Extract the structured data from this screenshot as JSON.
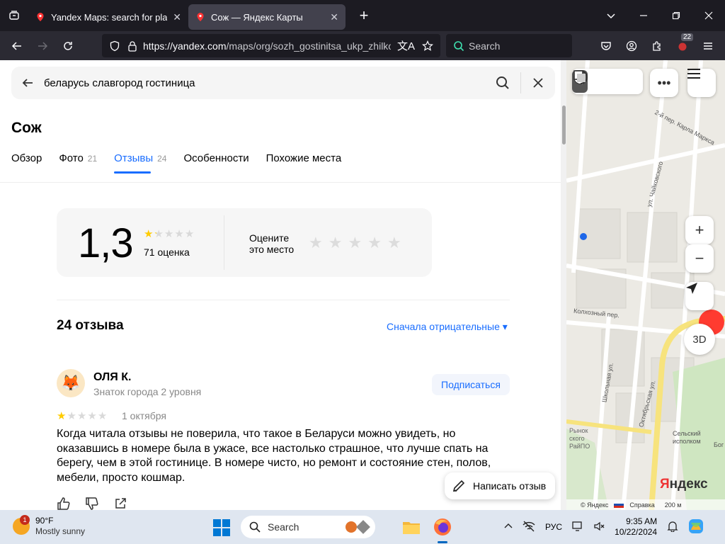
{
  "browser": {
    "tabs": [
      {
        "title": "Yandex Maps: search for places,",
        "close": "✕"
      },
      {
        "title": "Сож — Яндекс Карты",
        "close": "✕"
      }
    ],
    "url_host": "https://yandex.com",
    "url_path": "/maps/org/sozh_gostinitsa_ukp_zhilkom",
    "search_placeholder": "Search",
    "extension_badge": "22"
  },
  "page": {
    "search_query": "беларусь славгород гостиница",
    "org_title": "Сож",
    "tabs": [
      {
        "label": "Обзор",
        "count": ""
      },
      {
        "label": "Фото",
        "count": "21"
      },
      {
        "label": "Отзывы",
        "count": "24"
      },
      {
        "label": "Особенности",
        "count": ""
      },
      {
        "label": "Похожие места",
        "count": ""
      }
    ],
    "rating": {
      "value": "1,3",
      "stars_filled": 1.3,
      "count_label": "71 оценка",
      "rate_prompt_line1": "Оцените",
      "rate_prompt_line2": "это место"
    },
    "reviews_count": "24 отзыва",
    "sort_label": "Сначала отрицательные ▾",
    "review": {
      "author": "ОЛЯ К.",
      "level": "Знаток города 2 уровня",
      "subscribe": "Подписаться",
      "stars": 1,
      "date": "1 октября",
      "text": "Когда читала отзывы не поверила, что такое в Беларуси можно увидеть, но оказавшись в номере была в ужасе, все настолько страшное, что лучше спать на берегу, чем в этой гостинице. В номере чисто, но ремонт и состояние стен, полов, мебели, просто кошмар."
    },
    "write_review": "Написать отзыв"
  },
  "map": {
    "streets": [
      "2-й пер. Карла Маркса",
      "ул. Чайковского",
      "Колхозный пер.",
      "Школьная ул.",
      "Октябрьская ул."
    ],
    "poi_market": "Рынок ского РайПО",
    "poi_council": "Сельский исполком",
    "poi_other": "Бог",
    "btn_3d": "3D",
    "logo": "Яндекс",
    "footer_copyright": "© Яндекс",
    "footer_help": "Справка",
    "scale": "200 м"
  },
  "taskbar": {
    "weather_temp": "90°F",
    "weather_desc": "Mostly sunny",
    "weather_badge": "1",
    "search_label": "Search",
    "lang": "РУС",
    "time": "9:35 AM",
    "date": "10/22/2024"
  },
  "colors": {
    "accent": "#196dff",
    "star_filled": "#fc0",
    "star_empty": "#d9d9d9",
    "chrome_dark": "#1c1b22"
  }
}
